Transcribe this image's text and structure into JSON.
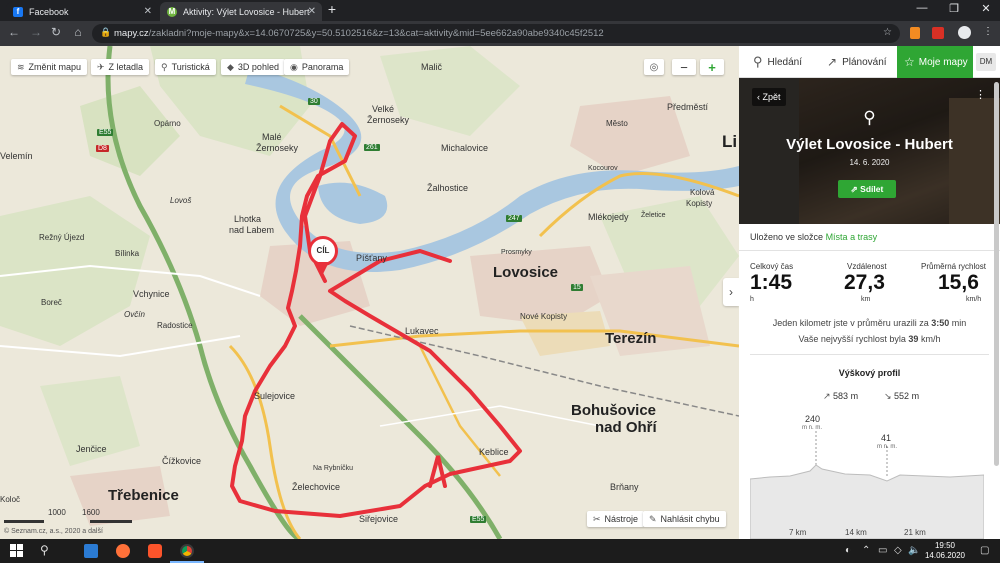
{
  "browser": {
    "tabs": [
      {
        "title": "Facebook",
        "active": false
      },
      {
        "title": "Aktivity: Výlet Lovosice - Hubert",
        "active": true
      }
    ],
    "new_tab": "+",
    "url_host": "mapy.cz",
    "url_path": "/zakladni?moje-mapy&x=14.0670725&y=50.5102516&z=13&cat=aktivity&mid=5ee662a90abe9340c45f2512",
    "avatar": "DM"
  },
  "map": {
    "controls": {
      "change_map": "Změnit mapu",
      "aerial": "Z letadla",
      "tourist": "Turistická",
      "view_3d": "3D pohled",
      "panorama": "Panorama",
      "zoom_out": "−",
      "zoom_in": "+"
    },
    "towns": [
      {
        "name": "Lovosice"
      },
      {
        "name": "Terezín"
      },
      {
        "name": "Bohušovice"
      },
      {
        "name": "nad Ohří"
      },
      {
        "name": "Třebenice"
      },
      {
        "name": "Li"
      }
    ],
    "places": [
      "Malič",
      "Velké",
      "Žernoseky",
      "Malé",
      "Žernoseky",
      "Michalovice",
      "Žalhostice",
      "Mlékojedy",
      "Lhotka",
      "nad Labem",
      "Píšťany",
      "Prosmyky",
      "Nové Kopisty",
      "Lukavec",
      "Sulejovice",
      "Keblice",
      "Brňany",
      "Čížkovice",
      "Jenčice",
      "Želechovice",
      "Siřejovice",
      "Na Rybníčku",
      "Vchynice",
      "Radostice",
      "Boreč",
      "Bílinka",
      "Režný Újezd",
      "Opárno",
      "Velemín",
      "Lovoš",
      "Ovčín",
      "Předměstí",
      "Město",
      "Kolová",
      "Kopisty",
      "Koloč",
      "Želetice",
      "Kocourov"
    ],
    "road_numbers": [
      "30",
      "261",
      "247",
      "15",
      "E55",
      "D8",
      "E55"
    ],
    "finish_marker": "CÍL",
    "scale": {
      "left": "1000",
      "right": "1600",
      "unit": "m"
    },
    "copyright": "© Seznam.cz, a.s., 2020 a další",
    "bottom_buttons": {
      "tools": "Nástroje",
      "report": "Nahlásit chybu"
    }
  },
  "panel": {
    "tabs": [
      {
        "label": "Hledání",
        "active": false
      },
      {
        "label": "Plánování",
        "active": false
      },
      {
        "label": "Moje mapy",
        "active": true
      }
    ],
    "back": "Zpět",
    "title": "Výlet Lovosice - Hubert",
    "date": "14. 6. 2020",
    "share": "Sdílet",
    "saved_prefix": "Uloženo ve složce",
    "saved_folder": "Místa a trasy",
    "stats": [
      {
        "label": "Celkový čas",
        "value": "1:45",
        "unit": "h"
      },
      {
        "label": "Vzdálenost",
        "value": "27,3",
        "unit": "km"
      },
      {
        "label": "Průměrná rychlost",
        "value": "15,6",
        "unit": "km/h"
      }
    ],
    "pace_prefix": "Jeden kilometr jste v průměru urazili za",
    "pace_value": "3:50",
    "pace_unit": "min",
    "max_prefix": "Vaše nejvyšší rychlost byla",
    "max_value": "39",
    "max_unit": "km/h",
    "profile_title": "Výškový profil",
    "ascent": "583 m",
    "descent": "552 m",
    "elev_high": "240",
    "elev_high_unit": "m n. m.",
    "elev_low": "41",
    "elev_low_unit": "m n. m.",
    "km_ticks": [
      "7 km",
      "14 km",
      "21 km"
    ]
  },
  "taskbar": {
    "time": "19:50",
    "date": "14.06.2020"
  },
  "colors": {
    "accent_green": "#2fa634",
    "route_red": "#e8303a",
    "panel_tab_active": "#2fa634"
  }
}
